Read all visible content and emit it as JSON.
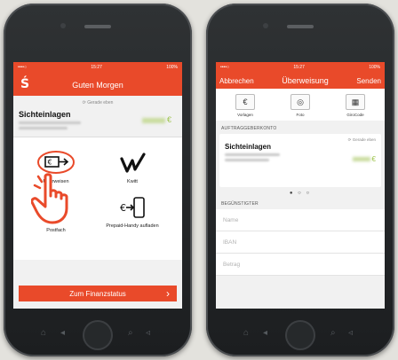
{
  "left_phone": {
    "status": {
      "carrier": "••••○ ",
      "time": "15:27",
      "battery": "100%"
    },
    "header": {
      "logo": "Ś",
      "greeting": "Guten Morgen"
    },
    "refresh": "Gerade eben",
    "account": {
      "title": "Sichteinlagen",
      "currency": "€"
    },
    "tiles": [
      {
        "label": "Überweisen"
      },
      {
        "label": "Kwitt"
      },
      {
        "label": "Postfach"
      },
      {
        "label": "Prepaid-Handy aufladen"
      }
    ],
    "cta": {
      "label": "Zum Finanzstatus"
    }
  },
  "right_phone": {
    "status": {
      "carrier": "••••○ ",
      "time": "15:27",
      "battery": "100%"
    },
    "header": {
      "cancel": "Abbrechen",
      "title": "Überweisung",
      "send": "Senden"
    },
    "actions": [
      {
        "label": "Vorlagen",
        "icon": "template-icon"
      },
      {
        "label": "Foto",
        "icon": "camera-icon"
      },
      {
        "label": "GiroCode",
        "icon": "qr-code-icon"
      }
    ],
    "section_payer": "AUFTRAGGEBERKONTO",
    "account_card": {
      "refresh": "Gerade eben",
      "title": "Sichteinlagen",
      "currency": "€"
    },
    "section_recipient": "BEGÜNSTIGTER",
    "fields": {
      "name": "Name",
      "iban": "IBAN",
      "amount": "Betrag"
    }
  },
  "colors": {
    "brand": "#e94a2a",
    "positive": "#9cc34a"
  }
}
